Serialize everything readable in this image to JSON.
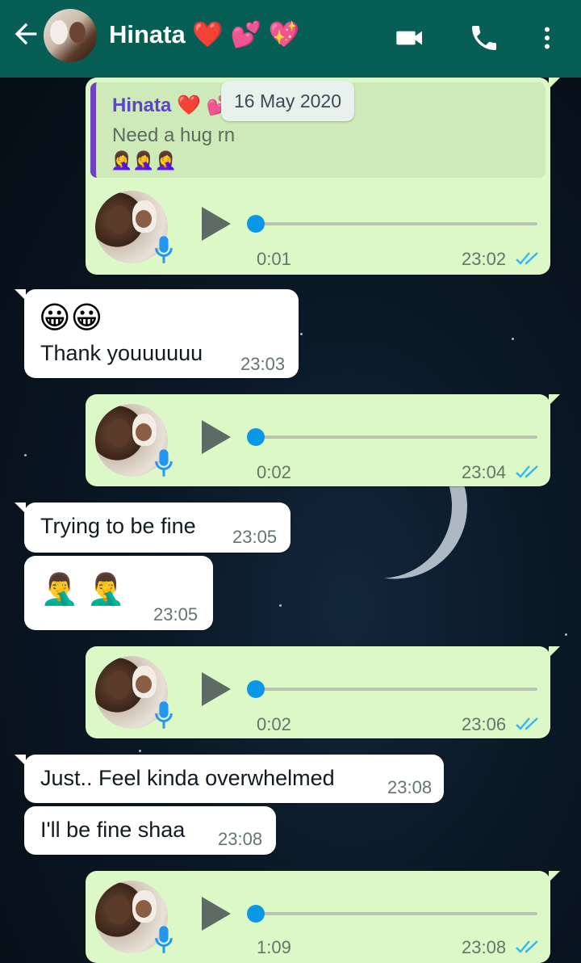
{
  "header": {
    "back_icon": "arrow-left-icon",
    "contact_name": "Hinata ❤️ 💕 💖",
    "video_call_icon": "video-camera-icon",
    "voice_call_icon": "phone-icon",
    "menu_icon": "more-vertical-icon"
  },
  "date_chip": "16 May 2020",
  "messages": [
    {
      "direction": "out",
      "type": "voice",
      "reply_to": {
        "name": "Hinata ❤️ 💕",
        "text": "Need a hug rn",
        "emoji": "🤦‍♀️🤦‍♀️🤦‍♀️"
      },
      "duration": "0:01",
      "time": "23:02",
      "progress": 0
    },
    {
      "direction": "in",
      "type": "text",
      "emoji": "😀😀",
      "text": "Thank youuuuuu",
      "time": "23:03"
    },
    {
      "direction": "out",
      "type": "voice",
      "duration": "0:02",
      "time": "23:04",
      "progress": 0
    },
    {
      "direction": "in",
      "type": "text",
      "text": "Trying to be fine",
      "time": "23:05"
    },
    {
      "direction": "in",
      "type": "emoji",
      "emoji": "🤦‍♂️ 🤦‍♂️",
      "time": "23:05"
    },
    {
      "direction": "out",
      "type": "voice",
      "duration": "0:02",
      "time": "23:06",
      "progress": 0
    },
    {
      "direction": "in",
      "type": "text",
      "text": "Just.. Feel kinda overwhelmed",
      "time": "23:08"
    },
    {
      "direction": "in",
      "type": "text",
      "text": "I'll be fine shaa",
      "time": "23:08"
    },
    {
      "direction": "out",
      "type": "voice",
      "duration": "1:09",
      "time": "23:08",
      "progress": 0
    }
  ],
  "colors": {
    "header": "#075e54",
    "outgoing_bubble": "#dcf8c6",
    "incoming_bubble": "#ffffff",
    "read_ticks": "#34b7f1",
    "voice_dot": "#0a97e6",
    "mic": "#2196f3"
  }
}
